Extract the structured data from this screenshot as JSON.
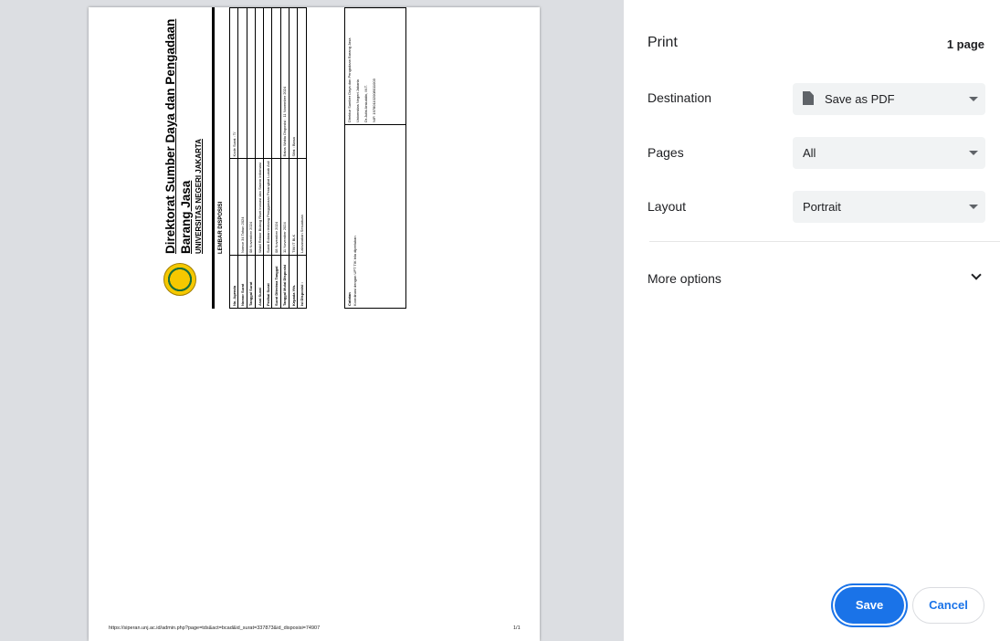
{
  "panel": {
    "title": "Print",
    "page_count": "1 page",
    "destination": {
      "label": "Destination",
      "value": "Save as PDF"
    },
    "pages": {
      "label": "Pages",
      "value": "All"
    },
    "layout": {
      "label": "Layout",
      "value": "Portrait"
    },
    "more_options": "More options",
    "save": "Save",
    "cancel": "Cancel"
  },
  "preview": {
    "footer_url": "https://siperan.unj.ac.id/admin.php?page=tds&act=bcad&id_surat=337873&id_disposisi=74907",
    "footer_page": "1/1",
    "form": {
      "title_line1": "Direktorat Sumber Daya dan Pengadaan",
      "title_line2": "Barang Jasa",
      "title_line3": "UNIVERSITAS NEGERI JAKARTA",
      "section": "LEMBAR DISPOSISI",
      "rows": [
        {
          "label": "No. Agenda",
          "value": "",
          "extra": "Kode Surat : T/"
        },
        {
          "label": "Nomor Surat",
          "value": "Nomor 34 Tahun 2024",
          "extra": ""
        },
        {
          "label": "Tanggal Surat",
          "value": "08 November 2024",
          "extra": ""
        },
        {
          "label": "Asal Surat",
          "value": "Wakil Rektor Bidang Riset Inovasi dan Sistem Informasi",
          "extra": ""
        },
        {
          "label": "Perihal Surat",
          "value": "Surat Edaran tentang Penggunaan Perangkat Lunak Asli",
          "extra": ""
        },
        {
          "label": "Surat Diterima Tanggal",
          "value": "08 November 2024",
          "extra": ""
        },
        {
          "label": "Tanggal Mulai Disposisi",
          "value": "11 November 2024",
          "extra": "Batas Waktu Disposisi : 11 November 2024"
        },
        {
          "label": "Kepada Yth.",
          "value": "TIM IT BLK",
          "extra": "Sifat : Biasa"
        },
        {
          "label": "Isi Disposisi :",
          "value": "Laksanakan Sesuatuan",
          "extra": ""
        }
      ],
      "catatan_label": "Catatan",
      "catatan_text": "Koordinasi dengan UPT TIK bila diperlukan",
      "sign_lines": [
        "Direktur Sumber Daya dan Pengadaan Barang Jasa",
        "Universitas Negeri Jakarta",
        "Dr.Jufai Arsiuddin, M.T.",
        "NIP. 197801102008011003"
      ]
    }
  }
}
